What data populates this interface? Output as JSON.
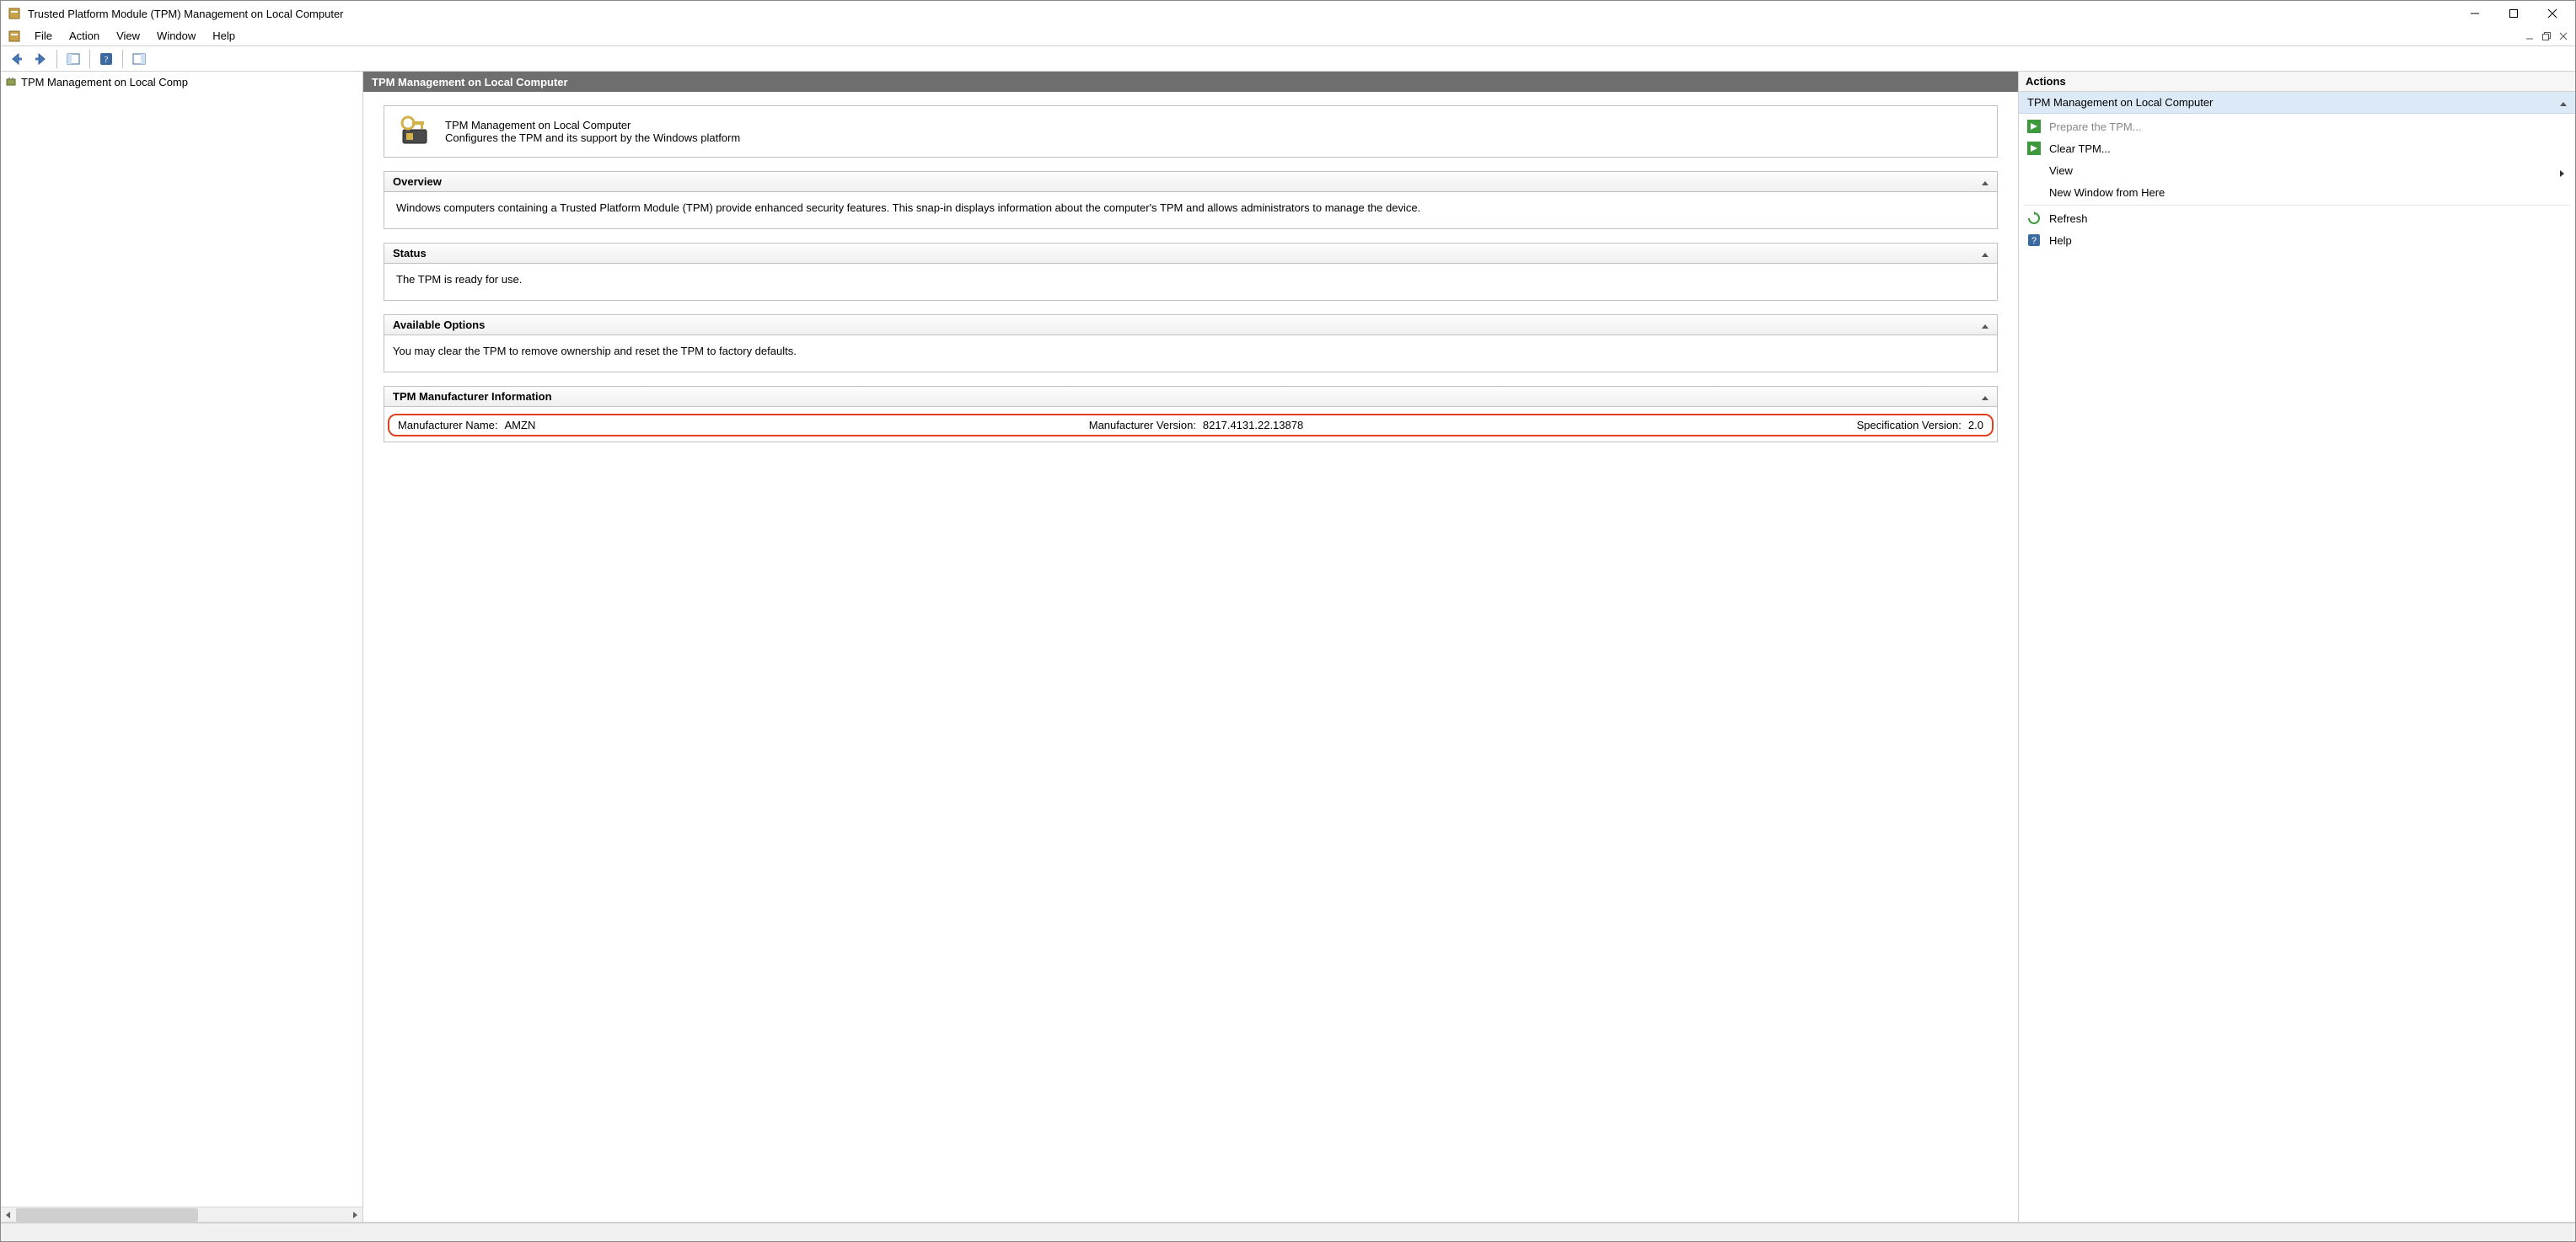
{
  "titlebar": {
    "title": "Trusted Platform Module (TPM) Management on Local Computer"
  },
  "menubar": {
    "items": [
      "File",
      "Action",
      "View",
      "Window",
      "Help"
    ]
  },
  "tree": {
    "root_label": "TPM Management on Local Comp"
  },
  "center": {
    "header": "TPM Management on Local Computer",
    "intro_title": "TPM Management on Local Computer",
    "intro_desc": "Configures the TPM and its support by the Windows platform",
    "overview": {
      "title": "Overview",
      "text": "Windows computers containing a Trusted Platform Module (TPM) provide enhanced security features. This snap-in displays information about the computer's TPM and allows administrators to manage the device."
    },
    "status": {
      "title": "Status",
      "text": "The TPM is ready for use."
    },
    "options": {
      "title": "Available Options",
      "text": "You may clear the TPM to remove ownership and reset the TPM to factory defaults."
    },
    "mfr": {
      "title": "TPM Manufacturer Information",
      "name_label": "Manufacturer Name:",
      "name_value": "AMZN",
      "ver_label": "Manufacturer Version:",
      "ver_value": "8217.4131.22.13878",
      "spec_label": "Specification Version:",
      "spec_value": "2.0"
    }
  },
  "actions": {
    "title": "Actions",
    "subheader": "TPM Management on Local Computer",
    "items": {
      "prepare": "Prepare the TPM...",
      "clear": "Clear TPM...",
      "view": "View",
      "new_window": "New Window from Here",
      "refresh": "Refresh",
      "help": "Help"
    }
  }
}
